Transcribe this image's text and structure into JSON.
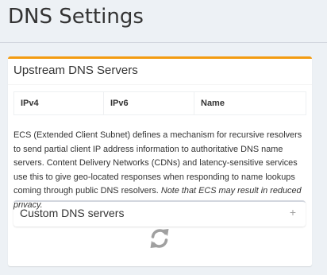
{
  "page": {
    "title": "DNS Settings"
  },
  "upstream": {
    "title": "Upstream DNS Servers",
    "columns": [
      "IPv4",
      "IPv6",
      "Name"
    ]
  },
  "ecs": {
    "text": "ECS (Extended Client Subnet) defines a mechanism for recursive resolvers to send partial client IP address information to authoritative DNS name servers. Content Delivery Networks (CDNs) and latency-sensitive services use this to give geo-located responses when responding to name lookups coming through public DNS resolvers.",
    "note": "Note that ECS may result in reduced privacy."
  },
  "custom_dns": {
    "title": "Custom DNS servers",
    "expand_symbol": "+"
  },
  "icons": {
    "expand": "plus-icon",
    "loading": "refresh-icon"
  },
  "colors": {
    "accent": "#f39c12",
    "background": "#edf1f5",
    "icon_gray": "#a0a0a0"
  }
}
